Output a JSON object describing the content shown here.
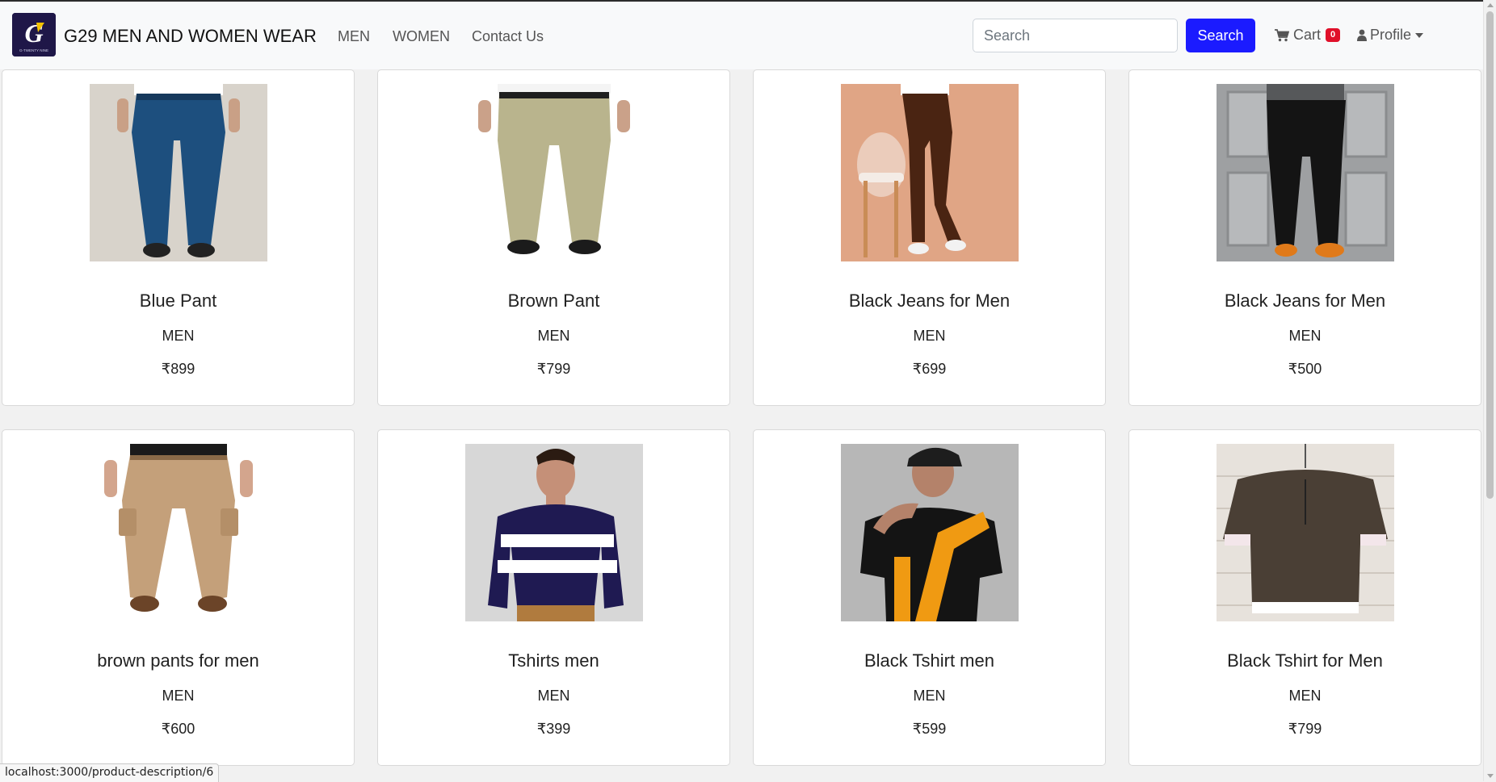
{
  "app": {
    "brand": "G29 MEN AND WOMEN WEAR",
    "logo_letter": "G",
    "logo_tagline": "G-TWENTY NINE"
  },
  "nav": {
    "links": [
      "MEN",
      "WOMEN",
      "Contact Us"
    ]
  },
  "search": {
    "placeholder": "Search",
    "value": "",
    "button_label": "Search"
  },
  "cart": {
    "label": "Cart",
    "count": "0",
    "icon": "shopping-cart-icon"
  },
  "profile": {
    "label": "Profile",
    "icon": "user-icon"
  },
  "products": [
    {
      "name": "Blue Pant",
      "category": "MEN",
      "price": "₹899",
      "image": "blue-trousers"
    },
    {
      "name": "Brown Pant",
      "category": "MEN",
      "price": "₹799",
      "image": "khaki-trousers"
    },
    {
      "name": "Black Jeans for Men",
      "category": "MEN",
      "price": "₹699",
      "image": "brown-trousers-chair"
    },
    {
      "name": "Black Jeans for Men",
      "category": "MEN",
      "price": "₹500",
      "image": "black-trousers-orange-shoes"
    },
    {
      "name": "brown pants for men",
      "category": "MEN",
      "price": "₹600",
      "image": "cargo-pants"
    },
    {
      "name": "Tshirts men",
      "category": "MEN",
      "price": "₹399",
      "image": "striped-sweater"
    },
    {
      "name": "Black Tshirt men",
      "category": "MEN",
      "price": "₹599",
      "image": "black-orange-tshirt"
    },
    {
      "name": "Black Tshirt for Men",
      "category": "MEN",
      "price": "₹799",
      "image": "olive-tshirt"
    }
  ],
  "status": {
    "url": "localhost:3000/product-description/6"
  },
  "colors": {
    "primary": "#1b1bff",
    "badge": "#e0102a",
    "navbar_bg": "#f8f9fa",
    "logo_bg": "#1f1748"
  }
}
